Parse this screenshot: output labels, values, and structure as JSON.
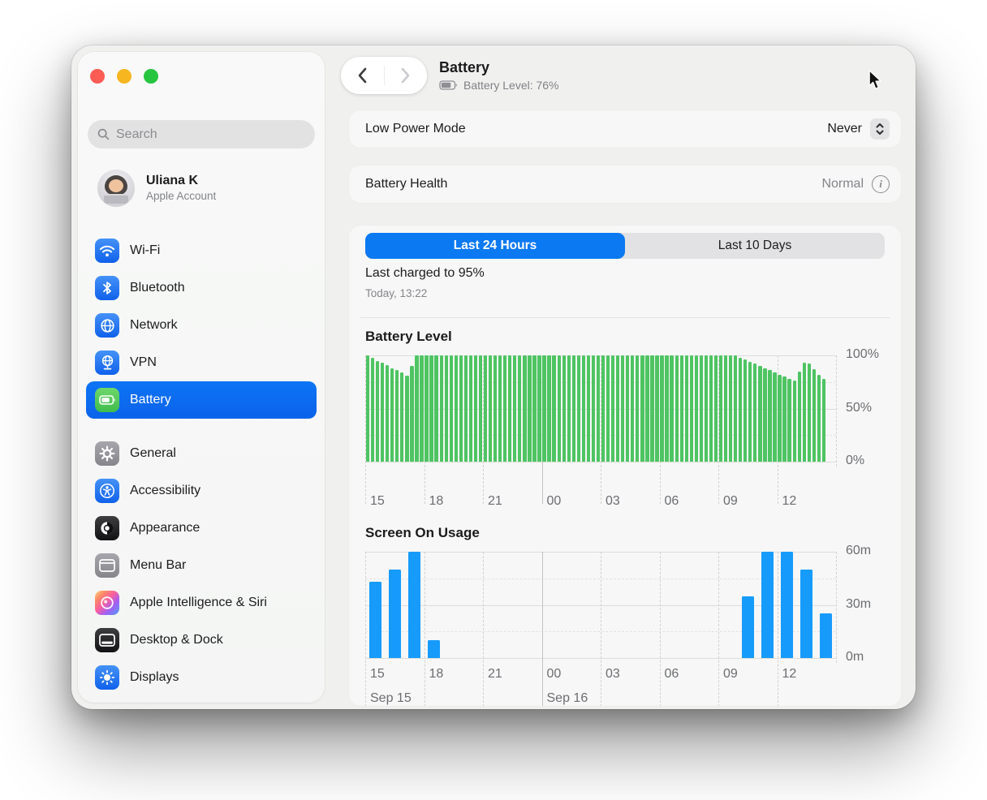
{
  "window": {
    "title": "Battery"
  },
  "header": {
    "battery_status": "Battery Level: 76%",
    "back_icon": "chevron-left",
    "forward_icon": "chevron-right"
  },
  "sidebar": {
    "search_placeholder": "Search",
    "user": {
      "name": "Uliana K",
      "subtitle": "Apple Account"
    },
    "groups": [
      {
        "items": [
          {
            "label": "Wi-Fi",
            "icon": "wifi-icon",
            "selected": false
          },
          {
            "label": "Bluetooth",
            "icon": "bluetooth-icon",
            "selected": false
          },
          {
            "label": "Network",
            "icon": "globe-icon",
            "selected": false
          },
          {
            "label": "VPN",
            "icon": "vpn-globe-icon",
            "selected": false
          },
          {
            "label": "Battery",
            "icon": "battery-icon",
            "selected": true
          }
        ]
      },
      {
        "items": [
          {
            "label": "General",
            "icon": "gear-icon",
            "selected": false
          },
          {
            "label": "Accessibility",
            "icon": "accessibility-icon",
            "selected": false
          },
          {
            "label": "Appearance",
            "icon": "appearance-icon",
            "selected": false
          },
          {
            "label": "Menu Bar",
            "icon": "menu-bar-icon",
            "selected": false
          },
          {
            "label": "Apple Intelligence & Siri",
            "icon": "siri-icon",
            "selected": false
          },
          {
            "label": "Desktop & Dock",
            "icon": "desktop-dock-icon",
            "selected": false
          },
          {
            "label": "Displays",
            "icon": "displays-icon",
            "selected": false
          }
        ]
      }
    ]
  },
  "content": {
    "rows": [
      {
        "label": "Low Power Mode",
        "value": "Never",
        "control": "popup-stepper"
      },
      {
        "label": "Battery Health",
        "value": "Normal",
        "control": "info-icon"
      }
    ],
    "tabs": [
      {
        "label": "Last 24 Hours",
        "selected": true
      },
      {
        "label": "Last 10 Days",
        "selected": false
      }
    ],
    "last_charged": {
      "title": "Last charged to 95%",
      "time": "Today, 13:22"
    }
  },
  "colors": {
    "accent_blue": "#0b79f2",
    "sidebar_selected_blue": "#0c6cef",
    "battery_bar_green": "#4ec462",
    "screen_bar_blue": "#169bfb",
    "traffic_red": "#fb5d55",
    "traffic_yellow": "#f5b61f",
    "traffic_green": "#27c53f"
  },
  "chart_data": [
    {
      "type": "bar",
      "title": "Battery Level",
      "ylabel": "charge percent",
      "interval_minutes": 15,
      "start_time": "15:00 Sep 15",
      "end_time": "~14:15 Sep 16",
      "ylim": [
        0,
        100
      ],
      "bar_color": "#4ec462",
      "y_ticks": [
        {
          "label": "100%",
          "value": 100
        },
        {
          "label": "50%",
          "value": 50
        },
        {
          "label": "0%",
          "value": 0
        }
      ],
      "y_minor": [
        75,
        25
      ],
      "x_ticks": [
        {
          "label": "15",
          "hour": 0
        },
        {
          "label": "18",
          "hour": 3
        },
        {
          "label": "21",
          "hour": 6
        },
        {
          "label": "00",
          "hour": 9,
          "solid": true
        },
        {
          "label": "03",
          "hour": 12
        },
        {
          "label": "06",
          "hour": 15
        },
        {
          "label": "09",
          "hour": 18
        },
        {
          "label": "12",
          "hour": 21
        }
      ],
      "hours_span": 24,
      "values": [
        100,
        98,
        95,
        93,
        91,
        88,
        86,
        84,
        81,
        90,
        100,
        100,
        100,
        100,
        100,
        100,
        100,
        100,
        100,
        100,
        100,
        100,
        100,
        100,
        100,
        100,
        100,
        100,
        100,
        100,
        100,
        100,
        100,
        100,
        100,
        100,
        100,
        100,
        100,
        100,
        100,
        100,
        100,
        100,
        100,
        100,
        100,
        100,
        100,
        100,
        100,
        100,
        100,
        100,
        100,
        100,
        100,
        100,
        100,
        100,
        100,
        100,
        100,
        100,
        100,
        100,
        100,
        100,
        100,
        100,
        100,
        100,
        100,
        100,
        100,
        100,
        98,
        96,
        94,
        92,
        90,
        88,
        86,
        84,
        82,
        80,
        78,
        76,
        85,
        93,
        92,
        87,
        82,
        78
      ]
    },
    {
      "type": "bar",
      "title": "Screen On Usage",
      "ylabel": "minutes per hour",
      "interval_minutes": 60,
      "start_time": "15:00 Sep 15",
      "end_time": "14:00 Sep 16",
      "ylim": [
        0,
        60
      ],
      "bar_color": "#169bfb",
      "y_ticks": [
        {
          "label": "60m",
          "value": 60
        },
        {
          "label": "30m",
          "value": 30
        },
        {
          "label": "0m",
          "value": 0
        }
      ],
      "y_minor": [
        45,
        15
      ],
      "x_ticks": [
        {
          "label": "15",
          "hour": 0
        },
        {
          "label": "18",
          "hour": 3
        },
        {
          "label": "21",
          "hour": 6
        },
        {
          "label": "00",
          "hour": 9,
          "solid": true
        },
        {
          "label": "03",
          "hour": 12
        },
        {
          "label": "06",
          "hour": 15
        },
        {
          "label": "09",
          "hour": 18
        },
        {
          "label": "12",
          "hour": 21
        }
      ],
      "day_labels": [
        {
          "label": "Sep 15",
          "hour": 0
        },
        {
          "label": "Sep 16",
          "hour": 9
        }
      ],
      "hours_span": 24,
      "values": [
        43,
        50,
        60,
        10,
        0,
        0,
        0,
        0,
        0,
        0,
        0,
        0,
        0,
        0,
        0,
        0,
        0,
        0,
        0,
        35,
        60,
        60,
        50,
        25
      ]
    }
  ]
}
